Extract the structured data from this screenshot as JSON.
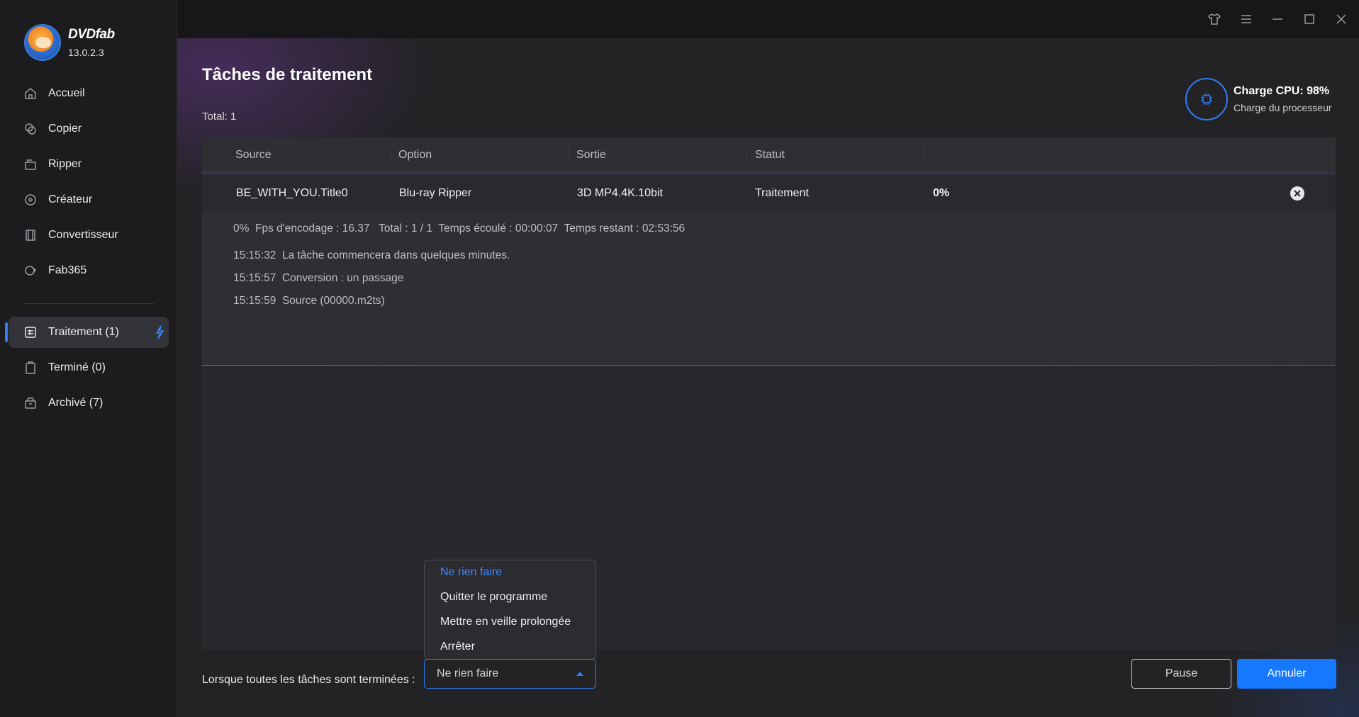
{
  "app": {
    "brand": "DVDfab",
    "version": "13.0.2.3"
  },
  "sidebar": {
    "items": [
      {
        "label": "Accueil",
        "icon": "home-icon"
      },
      {
        "label": "Copier",
        "icon": "copy-icon"
      },
      {
        "label": "Ripper",
        "icon": "ripper-icon"
      },
      {
        "label": "Créateur",
        "icon": "creator-icon"
      },
      {
        "label": "Convertisseur",
        "icon": "film-icon"
      },
      {
        "label": "Fab365",
        "icon": "fab365-icon"
      }
    ],
    "task_items": [
      {
        "label": "Traitement (1)",
        "icon": "processing-icon",
        "active": true
      },
      {
        "label": "Terminé (0)",
        "icon": "clipboard-icon",
        "active": false
      },
      {
        "label": "Archivé (7)",
        "icon": "archive-icon",
        "active": false
      }
    ]
  },
  "main": {
    "title": "Tâches de traitement",
    "total": "Total: 1"
  },
  "cpu": {
    "title": "Charge CPU: 98%",
    "subtitle": "Charge du processeur"
  },
  "table": {
    "headers": [
      "Source",
      "Option",
      "Sortie",
      "Statut"
    ],
    "row": {
      "source": "BE_WITH_YOU.Title0",
      "option": "Blu-ray Ripper",
      "output": "3D MP4.4K.10bit",
      "status": "Traitement",
      "progress": "0%"
    }
  },
  "details": {
    "summary": "0%  Fps d'encodage : 16.37   Total : 1 / 1  Temps écoulé : 00:00:07  Temps restant : 02:53:56",
    "log": [
      "15:15:32  La tâche commencera dans quelques minutes.",
      "15:15:57  Conversion : un passage",
      "15:15:59  Source (00000.m2ts)"
    ]
  },
  "footer": {
    "label": "Lorsque toutes les tâches sont terminées :",
    "select_value": "Ne rien faire",
    "options": [
      "Ne rien faire",
      "Quitter le programme",
      "Mettre en veille prolongée",
      "Arrêter"
    ],
    "pause": "Pause",
    "cancel": "Annuler"
  },
  "colors": {
    "accent": "#1677ff",
    "background": "#232326",
    "sidebar": "#1c1c1f"
  }
}
